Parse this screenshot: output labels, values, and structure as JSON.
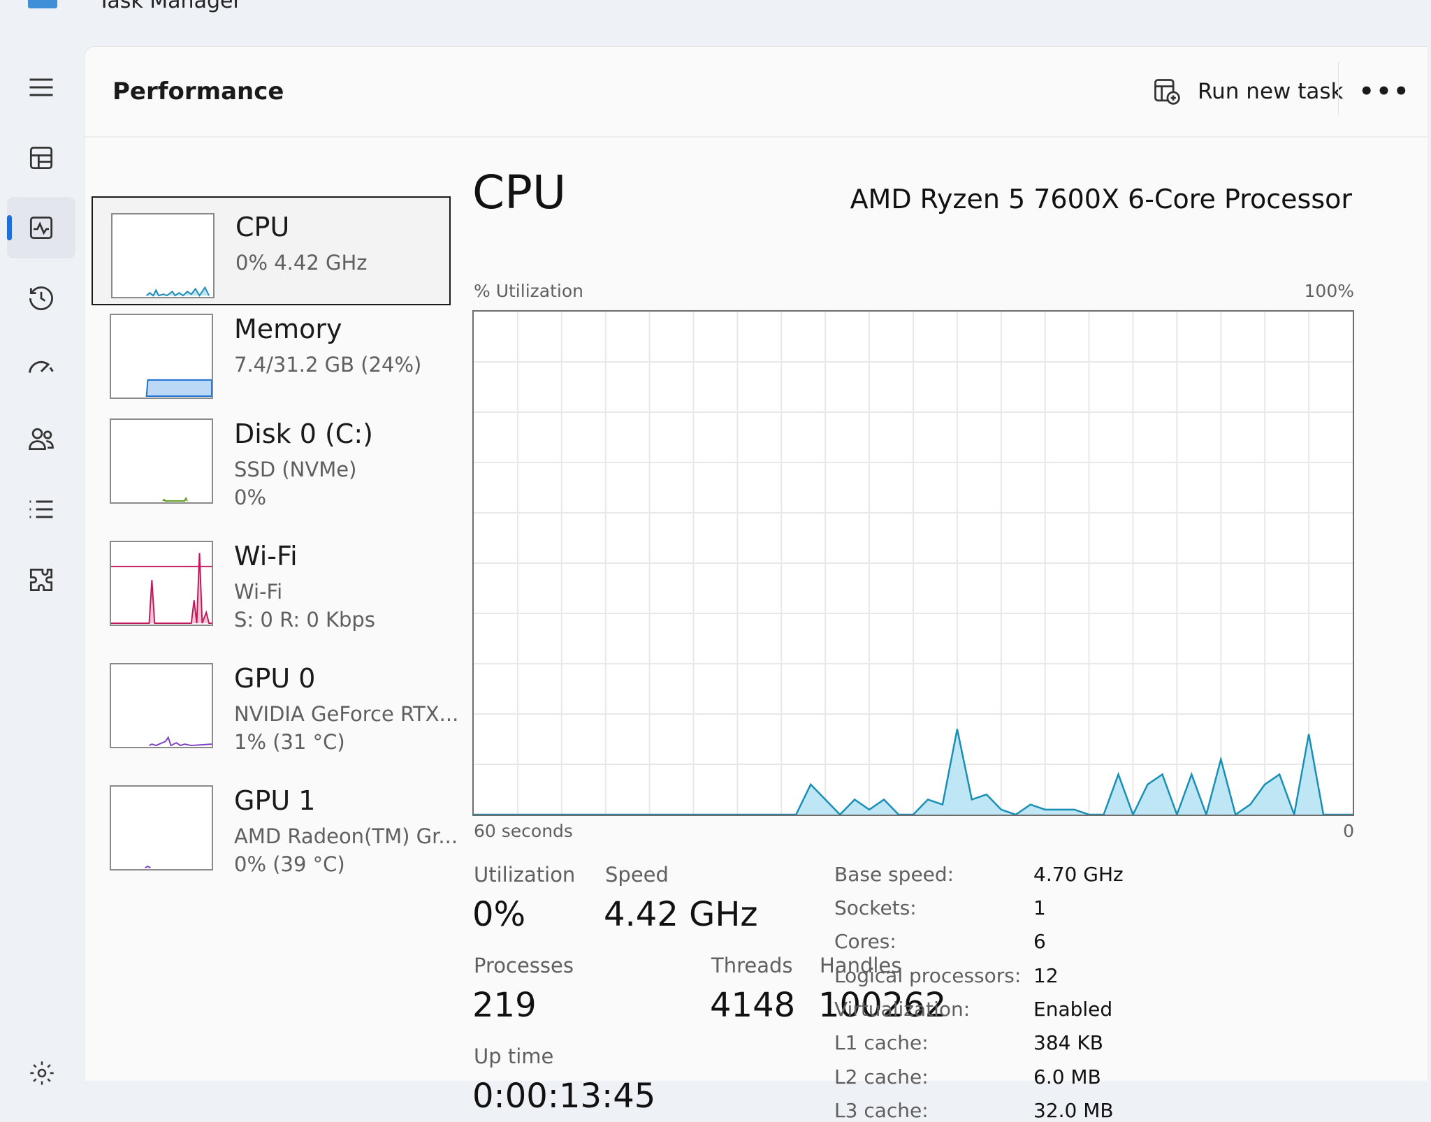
{
  "window": {
    "title": "Task Manager"
  },
  "header": {
    "title": "Performance",
    "run_new_task": "Run new task",
    "more": "•••"
  },
  "nav": [
    {
      "icon": "hamburger-menu-icon"
    },
    {
      "icon": "processes-icon"
    },
    {
      "icon": "performance-icon",
      "active": true
    },
    {
      "icon": "app-history-icon"
    },
    {
      "icon": "startup-apps-icon"
    },
    {
      "icon": "users-icon"
    },
    {
      "icon": "details-icon"
    },
    {
      "icon": "services-icon"
    },
    {
      "icon": "settings-icon"
    }
  ],
  "resources": [
    {
      "name": "CPU",
      "detail1": "0%  4.42 GHz",
      "detail2": "",
      "color": "#1f8ab8",
      "selected": true
    },
    {
      "name": "Memory",
      "detail1": "7.4/31.2 GB (24%)",
      "detail2": "",
      "color": "#1e6fd0"
    },
    {
      "name": "Disk 0 (C:)",
      "detail1": "SSD (NVMe)",
      "detail2": "0%",
      "color": "#5a9a1a"
    },
    {
      "name": "Wi-Fi",
      "detail1": "Wi-Fi",
      "detail2": "S: 0  R: 0 Kbps",
      "color": "#c2185b"
    },
    {
      "name": "GPU 0",
      "detail1": "NVIDIA GeForce RTX...",
      "detail2": "1%  (31 °C)",
      "color": "#7b3fc4"
    },
    {
      "name": "GPU 1",
      "detail1": "AMD Radeon(TM) Gr...",
      "detail2": "0%  (39 °C)",
      "color": "#7b3fc4"
    }
  ],
  "detail": {
    "title": "CPU",
    "processor": "AMD Ryzen 5 7600X 6-Core Processor",
    "graph_label": "% Utilization",
    "graph_max": "100%",
    "graph_time": "60 seconds",
    "graph_min": "0",
    "colors": {
      "line": "#1a8fb5",
      "fill": "#bfe6f5"
    },
    "stats": {
      "utilization_label": "Utilization",
      "utilization": "0%",
      "speed_label": "Speed",
      "speed": "4.42 GHz",
      "processes_label": "Processes",
      "processes": "219",
      "threads_label": "Threads",
      "threads": "4148",
      "handles_label": "Handles",
      "handles": "100262",
      "uptime_label": "Up time",
      "uptime": "0:00:13:45"
    },
    "specs": [
      {
        "label": "Base speed:",
        "value": "4.70 GHz"
      },
      {
        "label": "Sockets:",
        "value": "1"
      },
      {
        "label": "Cores:",
        "value": "6"
      },
      {
        "label": "Logical processors:",
        "value": "12"
      },
      {
        "label": "Virtualization:",
        "value": "Enabled"
      },
      {
        "label": "L1 cache:",
        "value": "384 KB"
      },
      {
        "label": "L2 cache:",
        "value": "6.0 MB"
      },
      {
        "label": "L3 cache:",
        "value": "32.0 MB"
      }
    ]
  },
  "chart_data": {
    "type": "area",
    "title": "",
    "xlabel": "60 seconds",
    "ylabel": "% Utilization",
    "xlim": [
      60,
      0
    ],
    "ylim": [
      0,
      100
    ],
    "grid": true,
    "x": [
      60,
      59,
      58,
      57,
      56,
      55,
      54,
      53,
      52,
      51,
      50,
      49,
      48,
      47,
      46,
      45,
      44,
      43,
      42,
      41,
      40,
      39,
      38,
      37,
      36,
      35,
      34,
      33,
      32,
      31,
      31,
      30,
      29,
      28,
      27,
      26,
      25,
      24,
      23,
      22,
      21,
      20,
      19,
      18,
      17,
      16,
      15,
      14,
      13,
      12,
      11,
      10,
      9,
      8,
      7,
      6,
      5,
      4,
      3,
      2,
      1,
      0
    ],
    "series": [
      {
        "values": [
          0,
          0,
          0,
          0,
          0,
          0,
          0,
          0,
          0,
          0,
          0,
          0,
          0,
          0,
          0,
          0,
          0,
          0,
          0,
          0,
          0,
          0,
          0,
          6,
          3,
          0,
          3,
          1,
          3,
          0,
          0,
          0,
          3,
          2,
          17,
          3,
          4,
          1,
          0,
          2,
          1,
          1,
          1,
          0,
          0,
          8,
          0,
          6,
          8,
          0,
          8,
          0,
          11,
          0,
          2,
          6,
          8,
          0,
          16,
          0,
          0,
          0
        ]
      }
    ]
  }
}
